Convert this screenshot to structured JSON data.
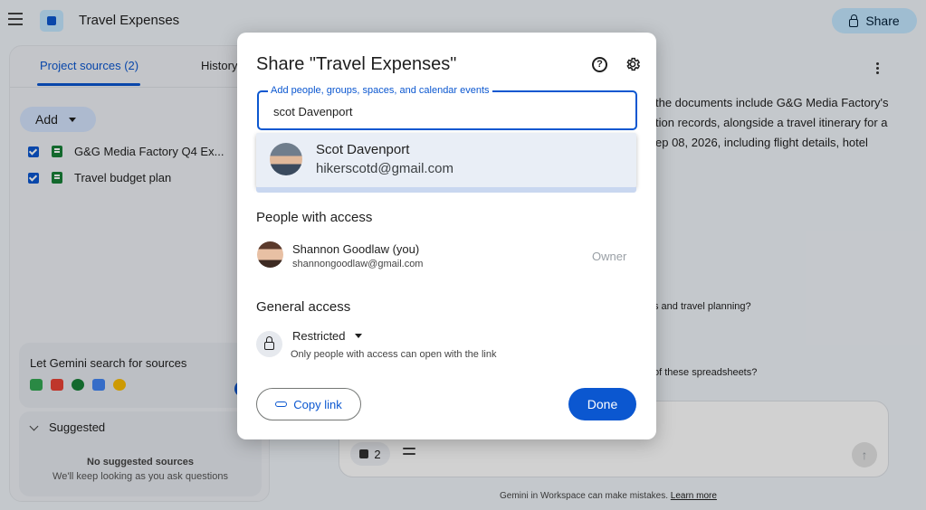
{
  "header": {
    "menu_icon": "menu-icon",
    "app_title": "Travel Expenses",
    "share_label": "Share"
  },
  "left_panel": {
    "tabs": [
      {
        "label": "Project sources (2)",
        "active": true
      },
      {
        "label": "History",
        "active": false
      }
    ],
    "add_label": "Add",
    "sources": [
      {
        "label": "G&G Media Factory Q4 Ex...",
        "checked": true,
        "icon": "sheets-icon"
      },
      {
        "label": "Travel budget plan",
        "checked": true,
        "icon": "sheets-icon"
      }
    ],
    "gemini_search": {
      "label": "Let Gemini search for sources"
    },
    "suggested": {
      "label": "Suggested",
      "empty_title": "No suggested sources",
      "empty_sub": "We'll keep looking as you ask questions"
    }
  },
  "main": {
    "summary_lines": [
      "the documents include G&G Media Factory's",
      "tion records, alongside a travel itinerary for a",
      "ep 08, 2026, including flight details, hotel"
    ],
    "question_1": "s and travel planning?",
    "question_2": "of these spreadsheets?",
    "chat": {
      "source_count": "2"
    },
    "footer_text": "Gemini in Workspace can make mistakes.",
    "footer_link": "Learn more"
  },
  "dialog": {
    "title": "Share \"Travel Expenses\"",
    "input_label": "Add people, groups, spaces, and calendar events",
    "input_value": "scot Davenport",
    "suggestion": {
      "name": "Scot Davenport",
      "email": "hikerscotd@gmail.com"
    },
    "people_heading": "People with access",
    "owner": {
      "name": "Shannon Goodlaw (you)",
      "email": "shannongoodlaw@gmail.com",
      "role": "Owner"
    },
    "general_heading": "General access",
    "access_level": "Restricted",
    "access_desc": "Only people with access can open with the link",
    "copy_link_label": "Copy link",
    "done_label": "Done"
  },
  "colors": {
    "accent": "#0b57d0",
    "share_bg": "#c2e7ff",
    "background": "#f0f4f9"
  }
}
